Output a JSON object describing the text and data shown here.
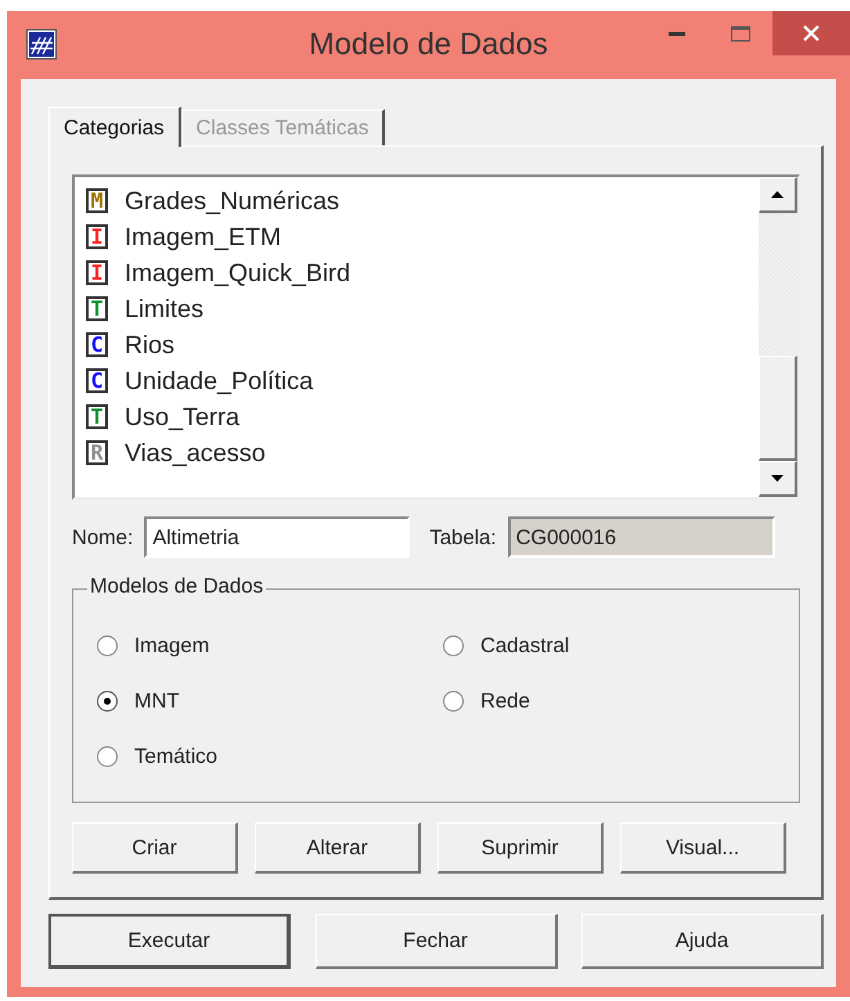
{
  "window": {
    "title": "Modelo de Dados"
  },
  "tabs": [
    {
      "label": "Categorias",
      "selected": true
    },
    {
      "label": "Classes Temáticas",
      "selected": false
    }
  ],
  "categories": [
    {
      "letter": "M",
      "color": "#a07000",
      "name": "Grades_Numéricas"
    },
    {
      "letter": "I",
      "color": "#ff2020",
      "name": "Imagem_ETM"
    },
    {
      "letter": "I",
      "color": "#ff2020",
      "name": "Imagem_Quick_Bird"
    },
    {
      "letter": "T",
      "color": "#109030",
      "name": "Limites"
    },
    {
      "letter": "C",
      "color": "#1010ff",
      "name": "Rios"
    },
    {
      "letter": "C",
      "color": "#1010ff",
      "name": "Unidade_Política"
    },
    {
      "letter": "T",
      "color": "#109030",
      "name": "Uso_Terra"
    },
    {
      "letter": "R",
      "color": "#909090",
      "name": "Vias_acesso"
    }
  ],
  "nome": {
    "label": "Nome:",
    "value": "Altimetria"
  },
  "tabela": {
    "label": "Tabela:",
    "value": "CG000016",
    "disabled": true
  },
  "group": {
    "title": "Modelos de Dados",
    "options": [
      {
        "label": "Imagem",
        "selected": false
      },
      {
        "label": "Cadastral",
        "selected": false
      },
      {
        "label": "MNT",
        "selected": true
      },
      {
        "label": "Rede",
        "selected": false
      },
      {
        "label": "Temático",
        "selected": false
      }
    ]
  },
  "panel_buttons": [
    "Criar",
    "Alterar",
    "Suprimir",
    "Visual..."
  ],
  "dialog_buttons": [
    {
      "label": "Executar",
      "default": true
    },
    {
      "label": "Fechar",
      "default": false
    },
    {
      "label": "Ajuda",
      "default": false
    }
  ]
}
